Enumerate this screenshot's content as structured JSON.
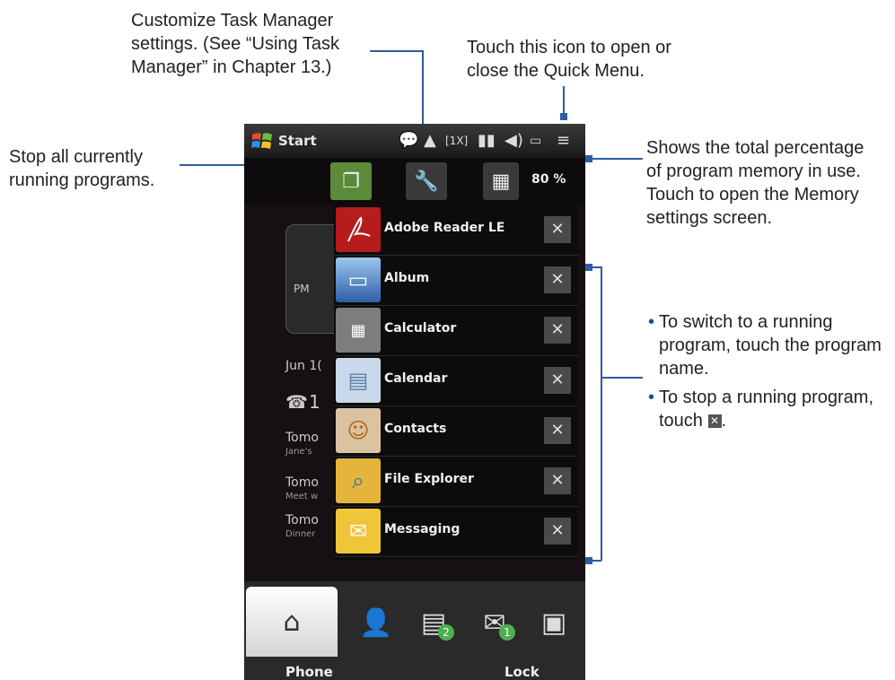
{
  "callouts": {
    "task_manager": [
      "Customize Task Manager",
      "settings. (See “Using Task",
      "Manager” in Chapter 13.)"
    ],
    "quick_menu": [
      "Touch this icon to open or",
      "close the Quick Menu."
    ],
    "stop_all": [
      "Stop all currently",
      "running programs."
    ],
    "memory": [
      "Shows the total percentage",
      "of program memory in use.",
      "Touch to open the Memory",
      "settings screen."
    ],
    "bullet1": "To switch to a running program, touch the program name.",
    "bullet2": "To stop a running program, touch",
    "bullet2_end": "."
  },
  "statusbar": {
    "start": "Start",
    "icons": [
      "chat-icon",
      "signal-tower-icon",
      "mode-1x-icon",
      "signal-bars-icon",
      "volume-icon",
      "battery-icon",
      "quick-menu-icon"
    ]
  },
  "toolbar": {
    "memory_percent": "80 %"
  },
  "background": {
    "pm": "PM",
    "date": "Jun 1(",
    "call_count": "1",
    "rows": [
      {
        "title": "Tomo",
        "sub": "Jane's"
      },
      {
        "title": "Tomo",
        "sub": "Meet w"
      },
      {
        "title": "Tomo",
        "sub": "Dinner"
      }
    ]
  },
  "tasks": [
    {
      "name": "Adobe Reader LE",
      "icon": "adobe-reader-icon",
      "color": "#b71c1c"
    },
    {
      "name": "Album",
      "icon": "album-icon",
      "color": "#3f74b8"
    },
    {
      "name": "Calculator",
      "icon": "calculator-icon",
      "color": "#7d7d7d"
    },
    {
      "name": "Calendar",
      "icon": "calendar-icon",
      "color": "#c9d9ea"
    },
    {
      "name": "Contacts",
      "icon": "contacts-icon",
      "color": "#d9c3a0"
    },
    {
      "name": "File Explorer",
      "icon": "file-explorer-icon",
      "color": "#e5b43c"
    },
    {
      "name": "Messaging",
      "icon": "messaging-icon",
      "color": "#f0c53a"
    }
  ],
  "tabbar": {
    "left_label": "Phone",
    "right_label": "Lock",
    "tabs": [
      "home-icon",
      "people-icon",
      "messages-icon",
      "email-icon",
      "camera-icon"
    ],
    "messages_badge": "2",
    "email_badge": "1"
  },
  "colors": {
    "connector": "#2b5ea0",
    "kill_button": "#5b8a3a"
  }
}
